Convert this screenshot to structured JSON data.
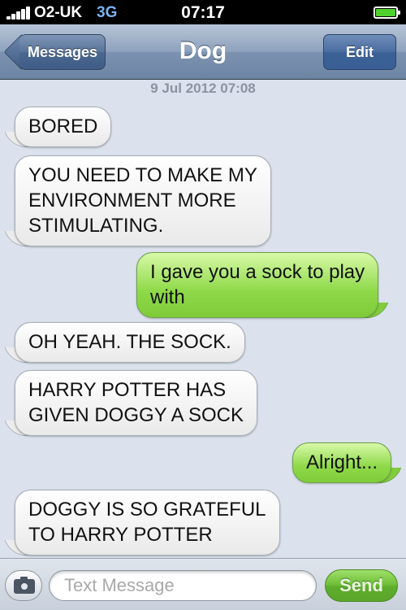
{
  "status_bar": {
    "carrier": "O2-UK",
    "network": "3G",
    "time": "07:17",
    "signal_icon": "signal-bars-icon",
    "battery_icon": "battery-full-icon",
    "colors": {
      "network": "#7ab2f0",
      "battery": "#4fd22d"
    }
  },
  "nav": {
    "back_label": "Messages",
    "title": "Dog",
    "edit_label": "Edit"
  },
  "conversation": {
    "timestamp": "9 Jul 2012 07:08",
    "messages": [
      {
        "from": "received",
        "text": "BORED"
      },
      {
        "from": "received",
        "lines": [
          "YOU NEED TO MAKE MY",
          "ENVIRONMENT MORE",
          "STIMULATING."
        ]
      },
      {
        "from": "sent",
        "lines": [
          "I gave you a sock to play",
          "with"
        ]
      },
      {
        "from": "received",
        "text": "OH YEAH. THE SOCK."
      },
      {
        "from": "received",
        "lines": [
          "HARRY POTTER HAS",
          "GIVEN DOGGY A SOCK"
        ]
      },
      {
        "from": "sent",
        "text": "Alright..."
      },
      {
        "from": "received",
        "lines": [
          "DOGGY IS SO GRATEFUL",
          "TO HARRY POTTER"
        ]
      }
    ],
    "colors": {
      "sent_bubble": "#8ed948",
      "received_bubble": "#ffffff",
      "background": "#dbe2ed"
    }
  },
  "input_bar": {
    "camera_icon": "camera-icon",
    "placeholder": "Text Message",
    "send_label": "Send",
    "colors": {
      "send_button": "#6cbc36"
    }
  }
}
